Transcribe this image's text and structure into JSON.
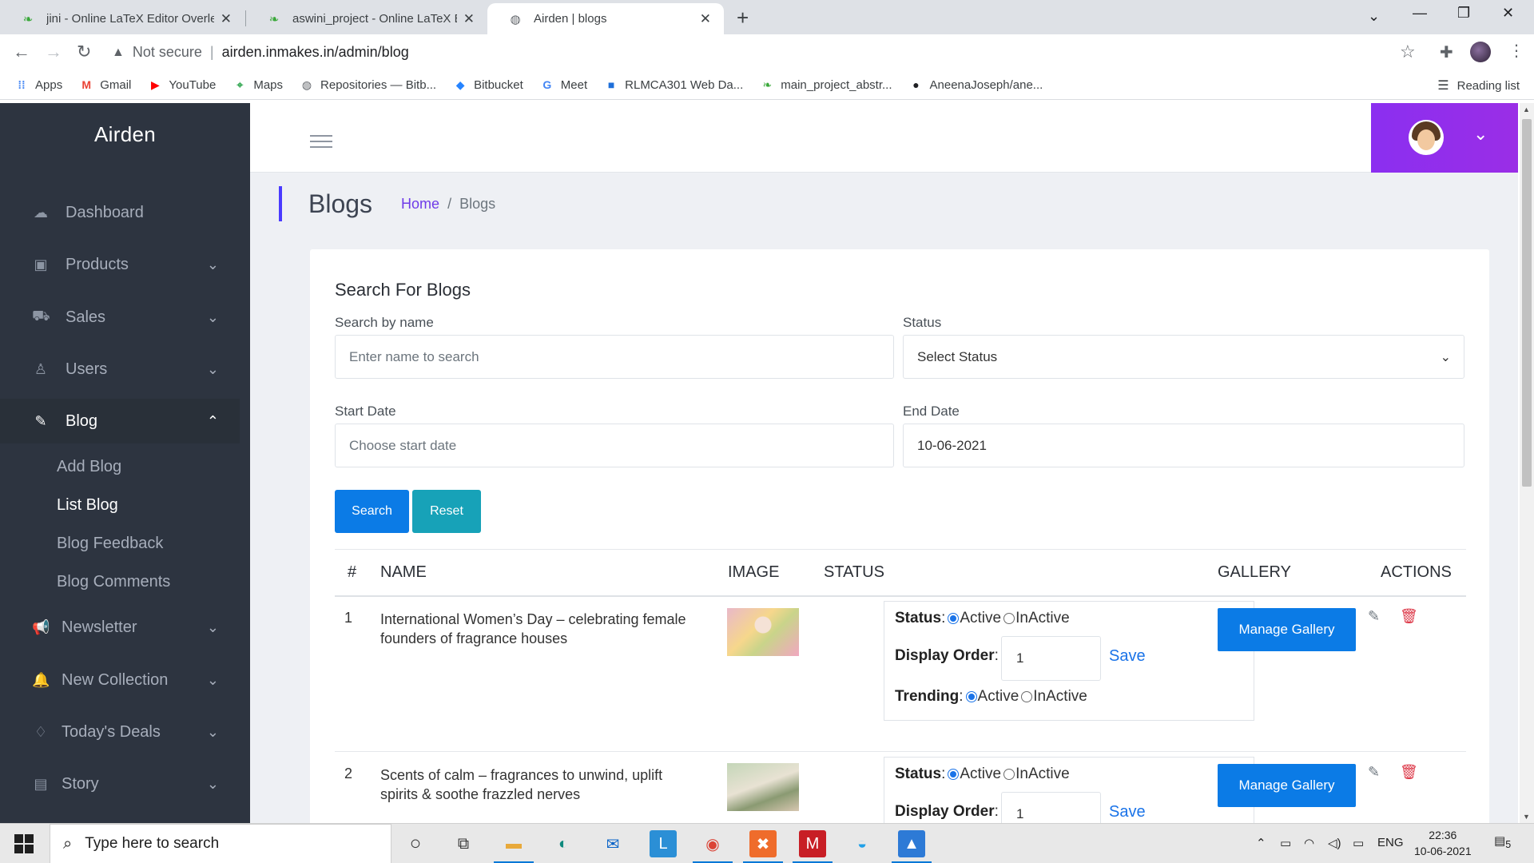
{
  "browser": {
    "tabs": [
      {
        "title": "jini - Online LaTeX Editor Overleaf",
        "favicon": "overleaf-icon"
      },
      {
        "title": "aswini_project - Online LaTeX Editor",
        "favicon": "overleaf-icon"
      },
      {
        "title": "Airden | blogs",
        "favicon": "globe-icon",
        "active": true
      }
    ],
    "security_label": "Not secure",
    "url": "airden.inmakes.in/admin/blog",
    "bookmarks": [
      {
        "label": "Apps",
        "icon": "apps-grid-icon"
      },
      {
        "label": "Gmail",
        "icon": "gmail-icon"
      },
      {
        "label": "YouTube",
        "icon": "youtube-icon"
      },
      {
        "label": "Maps",
        "icon": "maps-icon"
      },
      {
        "label": "Repositories — Bitb...",
        "icon": "globe-icon"
      },
      {
        "label": "Bitbucket",
        "icon": "bitbucket-icon"
      },
      {
        "label": "Meet",
        "icon": "google-icon"
      },
      {
        "label": "RLMCA301 Web Da...",
        "icon": "classroom-icon"
      },
      {
        "label": "main_project_abstr...",
        "icon": "overleaf-icon"
      },
      {
        "label": "AneenaJoseph/ane...",
        "icon": "github-icon"
      }
    ],
    "reading_list": "Reading list"
  },
  "sidebar": {
    "brand": "Airden",
    "items": [
      {
        "label": "Dashboard",
        "icon": "dashboard-icon"
      },
      {
        "label": "Products",
        "icon": "box-icon"
      },
      {
        "label": "Sales",
        "icon": "cart-icon"
      },
      {
        "label": "Users",
        "icon": "user-icon"
      },
      {
        "label": "Blog",
        "icon": "edit-icon",
        "expanded": true
      },
      {
        "label": "Newsletter",
        "icon": "megaphone-icon"
      },
      {
        "label": "New Collection",
        "icon": "bell-icon"
      },
      {
        "label": "Today's Deals",
        "icon": "bell-outline-icon"
      },
      {
        "label": "Story",
        "icon": "story-icon"
      }
    ],
    "blog_sub": [
      "Add Blog",
      "List Blog",
      "Blog Feedback",
      "Blog Comments"
    ],
    "active_sub": "List Blog"
  },
  "page": {
    "title": "Blogs",
    "breadcrumb": {
      "home": "Home",
      "sep": "/",
      "current": "Blogs"
    }
  },
  "search": {
    "title": "Search For Blogs",
    "name_label": "Search by name",
    "name_placeholder": "Enter name to search",
    "status_label": "Status",
    "status_selected": "Select Status",
    "start_label": "Start Date",
    "start_placeholder": "Choose start date",
    "end_label": "End Date",
    "end_value": "10-06-2021",
    "search_btn": "Search",
    "reset_btn": "Reset"
  },
  "table": {
    "headers": [
      "#",
      "NAME",
      "IMAGE",
      "STATUS",
      "GALLERY",
      "ACTIONS"
    ],
    "rows": [
      {
        "index": "1",
        "name": "International Women’s Day – celebrating female founders of fragrance houses",
        "status_label": "Status",
        "status_active": "Active",
        "status_inactive": "InActive",
        "order_label": "Display Order",
        "order_value": "1",
        "save": "Save",
        "trending_label": "Trending",
        "trending_active": "Active",
        "trending_inactive": "InActive",
        "gallery": "Manage Gallery"
      },
      {
        "index": "2",
        "name": "Scents of calm – fragrances to unwind, uplift spirits & soothe frazzled nerves",
        "status_label": "Status",
        "status_active": "Active",
        "status_inactive": "InActive",
        "order_label": "Display Order",
        "order_value": "1",
        "save": "Save",
        "gallery": "Manage Gallery"
      }
    ]
  },
  "taskbar": {
    "search_placeholder": "Type here to search",
    "lang": "ENG",
    "time": "22:36",
    "date": "10-06-2021",
    "notifications": "5"
  },
  "colors": {
    "sidebar_bg": "#2d3440",
    "accent_purple": "#8b2ff0",
    "primary_blue": "#0b7be6",
    "info_teal": "#17a2b8",
    "delete_red": "#dc3545"
  }
}
